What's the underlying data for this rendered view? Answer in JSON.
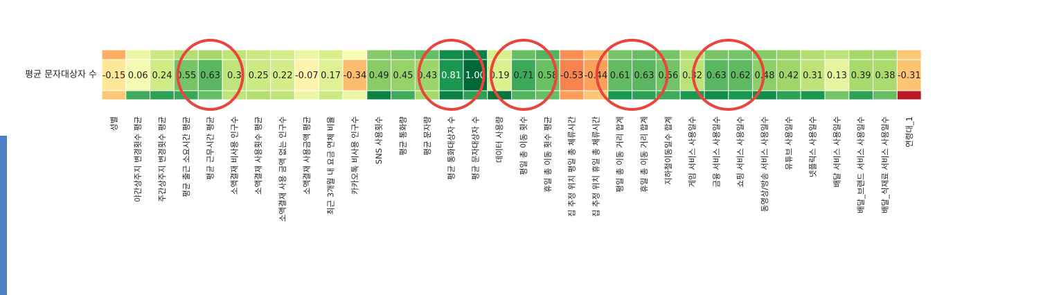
{
  "chart_data": {
    "type": "heatmap",
    "row_label": "평균 문자대상자 수",
    "columns": [
      "성별",
      "야간상주지 변경횟수 평균",
      "주간상주지 변경횟수 평균",
      "평균 출근 소요시간 평균",
      "평균 근무시간 평균",
      "소액결재 비사용 인구수",
      "소액결재 사용횟수 평균",
      "소액결재 사용 금액 없는 인구수",
      "소액결재 사용금액 평균",
      "최근 3개월 내 요금 연체 비율",
      "카카오톡 비사용 인구수",
      "SNS 사용횟수",
      "평균 통화량",
      "평균 문자량",
      "평균 통화대상자 수",
      "평균 문자대상자 수",
      "데이터 사용량",
      "평일 총 이동 횟수",
      "휴일 총 이동 횟수 평균",
      "집 추정 위치 평일 총 체류시간",
      "집 추정 위치 휴일 총 체류시간",
      "평일 총 이동 거리 합계",
      "휴일 총 이동 거리 합계",
      "지하철이동일수 합계",
      "게임 서비스 사용일수",
      "금융 서비스 사용일수",
      "쇼핑 서비스 사용일수",
      "동영상/방송 서비스 사용일수",
      "유튜브 사용일수",
      "넷플릭스 사용일수",
      "배달 서비스 사용일수",
      "배달_브랜드 서비스 사용일수",
      "배달_식재료 서비스 사용일수",
      "연령대_1"
    ],
    "values": [
      -0.15,
      0.06,
      0.24,
      0.55,
      0.63,
      0.3,
      0.25,
      0.22,
      -0.07,
      0.17,
      -0.34,
      0.49,
      0.45,
      0.43,
      0.81,
      1.0,
      0.19,
      0.71,
      0.58,
      -0.53,
      -0.44,
      0.61,
      0.63,
      0.56,
      0.32,
      0.63,
      0.62,
      0.48,
      0.42,
      0.31,
      0.13,
      0.39,
      0.38,
      -0.31
    ],
    "value_labels": [
      "-0.15",
      "0.06",
      "0.24",
      "0.55",
      "0.63",
      "0.3",
      "0.25",
      "0.22",
      "-0.07",
      "0.17",
      "-0.34",
      "0.49",
      "0.45",
      "0.43",
      "0.81",
      "1.00",
      "0.19",
      "0.71",
      "0.58",
      "-0.53",
      "-0.44",
      "0.61",
      "0.63",
      "0.56",
      "0.32",
      "0.63",
      "0.62",
      "0.48",
      "0.42",
      "0.31",
      "0.13",
      "0.39",
      "0.38",
      "-0.31"
    ],
    "above_row_values": [
      -0.4,
      0.1,
      0.25,
      0.35,
      0.4,
      0.3,
      0.25,
      0.22,
      0.1,
      0.2,
      0.05,
      0.5,
      0.55,
      0.6,
      0.85,
      0.9,
      0.2,
      0.6,
      0.65,
      -0.5,
      -0.35,
      0.55,
      0.6,
      0.55,
      0.35,
      0.55,
      0.55,
      0.5,
      0.45,
      0.35,
      0.3,
      0.4,
      0.4,
      -0.3
    ],
    "below_row_values": [
      -0.3,
      0.7,
      0.75,
      0.72,
      0.6,
      0.3,
      0.35,
      0.3,
      0.1,
      0.25,
      0.1,
      0.9,
      0.7,
      0.4,
      0.9,
      0.75,
      0.95,
      0.65,
      0.6,
      -0.45,
      -0.3,
      0.8,
      0.75,
      0.7,
      0.8,
      0.85,
      0.8,
      0.85,
      0.75,
      0.8,
      0.55,
      0.75,
      0.6,
      -0.9
    ],
    "highlighted_columns": [
      4,
      14,
      17,
      21,
      22,
      25,
      26
    ],
    "colormap": "RdYlGn",
    "vmin": -1,
    "vmax": 1,
    "annotation_color": "#e8453c"
  }
}
